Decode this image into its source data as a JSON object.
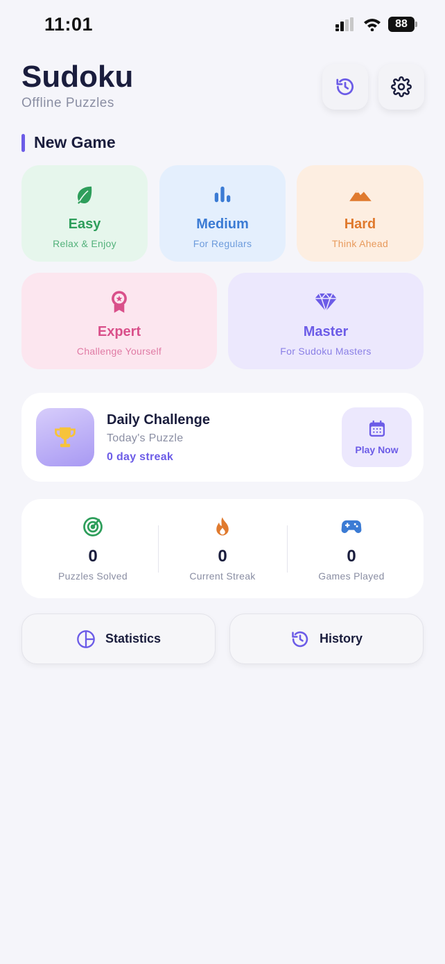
{
  "status_bar": {
    "time": "11:01",
    "battery": "88"
  },
  "header": {
    "title": "Sudoku",
    "subtitle": "Offline Puzzles"
  },
  "new_game": {
    "title": "New Game",
    "difficulties": [
      {
        "name": "Easy",
        "subtitle": "Relax & Enjoy",
        "icon": "leaf-icon",
        "color": "#2e9e5b",
        "bg": "#e6f6ec"
      },
      {
        "name": "Medium",
        "subtitle": "For Regulars",
        "icon": "bar-chart-icon",
        "color": "#3b7bd4",
        "bg": "#e4effd"
      },
      {
        "name": "Hard",
        "subtitle": "Think Ahead",
        "icon": "mountain-icon",
        "color": "#e07a2e",
        "bg": "#fdeee1"
      },
      {
        "name": "Expert",
        "subtitle": "Challenge Yourself",
        "icon": "award-icon",
        "color": "#d9508a",
        "bg": "#fce6ef"
      },
      {
        "name": "Master",
        "subtitle": "For Sudoku Masters",
        "icon": "diamond-icon",
        "color": "#6c5ce7",
        "bg": "#ece8fd"
      }
    ]
  },
  "daily_challenge": {
    "title": "Daily Challenge",
    "subtitle": "Today's Puzzle",
    "streak": "0 day streak",
    "play_label": "Play Now"
  },
  "stats": [
    {
      "value": "0",
      "label": "Puzzles Solved",
      "icon": "target-icon",
      "color": "#2e9e5b"
    },
    {
      "value": "0",
      "label": "Current Streak",
      "icon": "flame-icon",
      "color": "#e07a2e"
    },
    {
      "value": "0",
      "label": "Games Played",
      "icon": "gamepad-icon",
      "color": "#3b7bd4"
    }
  ],
  "buttons": {
    "statistics": "Statistics",
    "history": "History"
  },
  "colors": {
    "accent": "#6c5ce7",
    "background": "#f5f5fa"
  }
}
